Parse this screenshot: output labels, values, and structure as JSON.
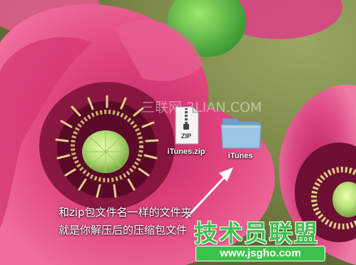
{
  "watermark": "三联网 3LIAN.COM",
  "desktop": {
    "icons": [
      {
        "label": "iTunes.zip",
        "badge": "ZIP",
        "icon": "zip-archive-icon"
      },
      {
        "label": "iTunes",
        "icon": "folder-icon"
      }
    ]
  },
  "caption": {
    "line1": "和zip包文件名一样的文件夹",
    "line2": "就是你解压后的压缩包文件"
  },
  "site_logo": {
    "name": "技术员联盟",
    "url": "www.jsgho.com"
  },
  "colors": {
    "flower_pink": "#e0457f",
    "folder_blue": "#8cb8da",
    "logo_green": "#3cc24a"
  }
}
